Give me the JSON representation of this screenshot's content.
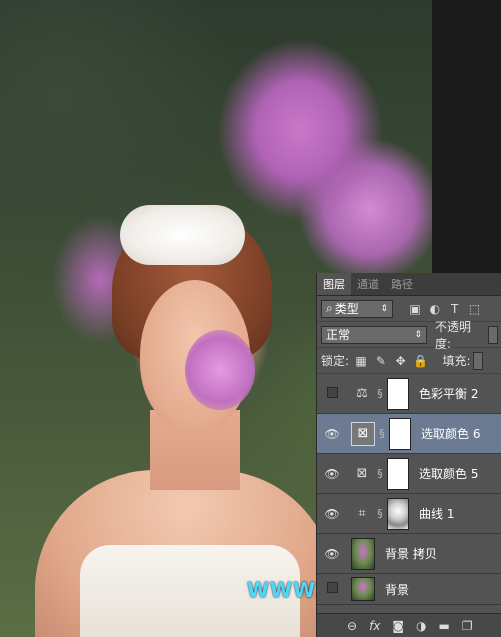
{
  "panel": {
    "tabs": [
      "图层",
      "通道",
      "路径"
    ],
    "filter_label": "类型",
    "blend_mode": "正常",
    "opacity_label": "不透明度:",
    "lock_label": "锁定:",
    "fill_label": "填充:",
    "layers": [
      {
        "name": "色彩平衡 2",
        "visible": false,
        "icon": "balance-scale-icon"
      },
      {
        "name": "选取颜色 6",
        "visible": true,
        "icon": "selective-color-icon",
        "selected": true
      },
      {
        "name": "选取颜色 5",
        "visible": true,
        "icon": "selective-color-icon"
      },
      {
        "name": "曲线 1",
        "visible": true,
        "icon": "curves-icon"
      },
      {
        "name": "背景 拷贝",
        "visible": true,
        "icon": "image-thumbnail"
      },
      {
        "name": "背景",
        "visible": false,
        "icon": "image-thumbnail"
      }
    ],
    "bottom_icons": [
      "link-icon",
      "fx-icon",
      "mask-icon",
      "adjustment-icon",
      "folder-icon",
      "new-layer-icon"
    ]
  },
  "watermark": "WWW.PSAHZ.COM",
  "colors": {
    "panel_bg": "#535353",
    "selected_row": "#6c7b91",
    "watermark": "#4fd8f2"
  }
}
